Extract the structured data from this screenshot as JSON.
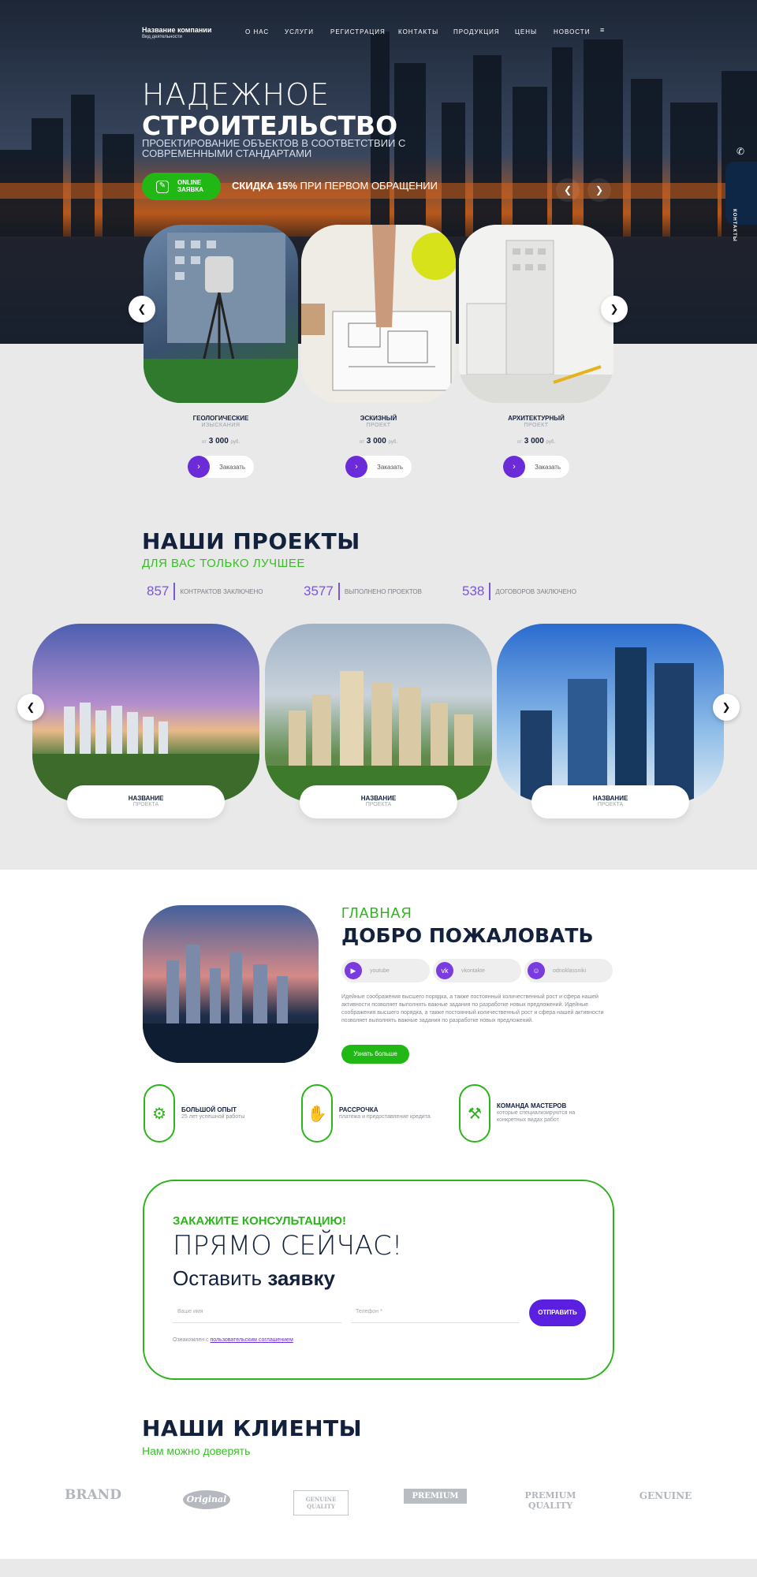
{
  "header": {
    "company_name": "Название компании",
    "company_sub": "Вид деятельности",
    "nav": [
      "О НАС",
      "УСЛУГИ",
      "РЕГИСТРАЦИЯ",
      "КОНТАКТЫ",
      "ПРОДУКЦИЯ",
      "ЦЕНЫ",
      "НОВОСТИ"
    ]
  },
  "hero": {
    "title_light": "НАДЕЖНОЕ",
    "title_bold": "СТРОИТЕЛЬСТВО",
    "subtitle": "ПРОЕКТИРОВАНИЕ ОБЪЕКТОВ В СООТВЕТСТВИИ С СОВРЕМЕННЫМИ СТАНДАРТАМИ",
    "online_btn_line1": "ONLINE",
    "online_btn_line2": "ЗАЯВКА",
    "discount_bold": "СКИДКА 15%",
    "discount_rest": " ПРИ ПЕРВОМ ОБРАЩЕНИИ",
    "side_tab": "КОНТАКТЫ"
  },
  "services": [
    {
      "title": "ГЕОЛОГИЧЕСКИЕ",
      "sub": "ИЗЫСКАНИЯ",
      "from": "от",
      "price": "3 000",
      "cur": "руб.",
      "button": "Заказать"
    },
    {
      "title": "ЭСКИЗНЫЙ",
      "sub": "ПРОЕКТ",
      "from": "от",
      "price": "3 000",
      "cur": "руб.",
      "button": "Заказать"
    },
    {
      "title": "АРХИТЕКТУРНЫЙ",
      "sub": "ПРОЕКТ",
      "from": "от",
      "price": "3 000",
      "cur": "руб.",
      "button": "Заказать"
    }
  ],
  "projects": {
    "title": "НАШИ ПРОЕКТЫ",
    "subtitle": "ДЛЯ ВАС ТОЛЬКО ЛУЧШЕЕ",
    "stats": [
      {
        "value": "857",
        "label": "КОНТРАКТОВ ЗАКЛЮЧЕНО"
      },
      {
        "value": "3577",
        "label": "ВЫПОЛНЕНО ПРОЕКТОВ"
      },
      {
        "value": "538",
        "label": "ДОГОВОРОВ ЗАКЛЮЧЕНО"
      }
    ],
    "items": [
      {
        "name": "НАЗВАНИЕ",
        "sub": "ПРОЕКТА"
      },
      {
        "name": "НАЗВАНИЕ",
        "sub": "ПРОЕКТА"
      },
      {
        "name": "НАЗВАНИЕ",
        "sub": "ПРОЕКТА"
      }
    ]
  },
  "about": {
    "kicker": "ГЛАВНАЯ",
    "title": "ДОБРО ПОЖАЛОВАТЬ",
    "socials": [
      {
        "label": "youtube",
        "icon": "youtube-icon"
      },
      {
        "label": "vkontakte",
        "icon": "vk-icon"
      },
      {
        "label": "odnoklassniki",
        "icon": "ok-icon"
      }
    ],
    "text": "Идейные соображения высшего порядка, а также постоянный количественный рост и сфера нашей активности позволяет выполнять важные задания по разработке новых предложений. Идейные соображения высшего порядка, а также постоянный количественный рост и сфера нашей активности позволяет выполнять важные задания по разработке новых предложений.",
    "button": "Узнать больше"
  },
  "features": [
    {
      "title": "БОЛЬШОЙ ОПЫТ",
      "text": "25 лет успешной работы"
    },
    {
      "title": "РАССРОЧКА",
      "text": "платежа и предоставление кредита"
    },
    {
      "title": "КОМАНДА МАСТЕРОВ",
      "text": "которые специализируются на конкретных видах работ"
    }
  ],
  "cta": {
    "kicker": "ЗАКАЖИТЕ КОНСУЛЬТАЦИЮ!",
    "title": "ПРЯМО СЕЙЧАС!",
    "line_light": "Оставить ",
    "line_bold": "заявку",
    "name_placeholder": "Ваше имя",
    "phone_placeholder": "Телефон *",
    "submit": "ОТПРАВИТЬ",
    "agree_text": "Ознакомлен с ",
    "agree_link": "пользовательским соглашением"
  },
  "clients": {
    "title": "НАШИ КЛИЕНТЫ",
    "subtitle": "Нам можно доверять",
    "logos": [
      "BRAND",
      "Original",
      "GENUINE QUALITY",
      "PREMIUM",
      "PREMIUM QUALITY",
      "GENUINE"
    ]
  },
  "colors": {
    "green": "#2cb51b",
    "purple": "#6c2bd9",
    "navy": "#13213d"
  }
}
